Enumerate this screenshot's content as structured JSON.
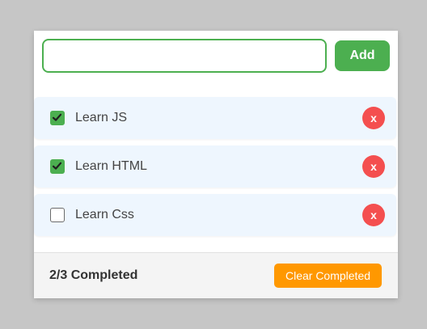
{
  "input": {
    "value": "",
    "placeholder": ""
  },
  "add_button": {
    "label": "Add"
  },
  "todos": [
    {
      "label": "Learn JS",
      "completed": true,
      "delete_label": "x"
    },
    {
      "label": "Learn HTML",
      "completed": true,
      "delete_label": "x"
    },
    {
      "label": "Learn Css",
      "completed": false,
      "delete_label": "x"
    }
  ],
  "footer": {
    "status": "2/3 Completed",
    "clear_label": "Clear Completed"
  },
  "colors": {
    "background": "#c6c6c6",
    "primary_green": "#4caf50",
    "delete_red": "#f44f4f",
    "clear_orange": "#ff9800",
    "item_bg": "#eef6fe"
  },
  "icons": {
    "checkbox_checked": "checkmark-icon",
    "delete": "close-icon"
  }
}
